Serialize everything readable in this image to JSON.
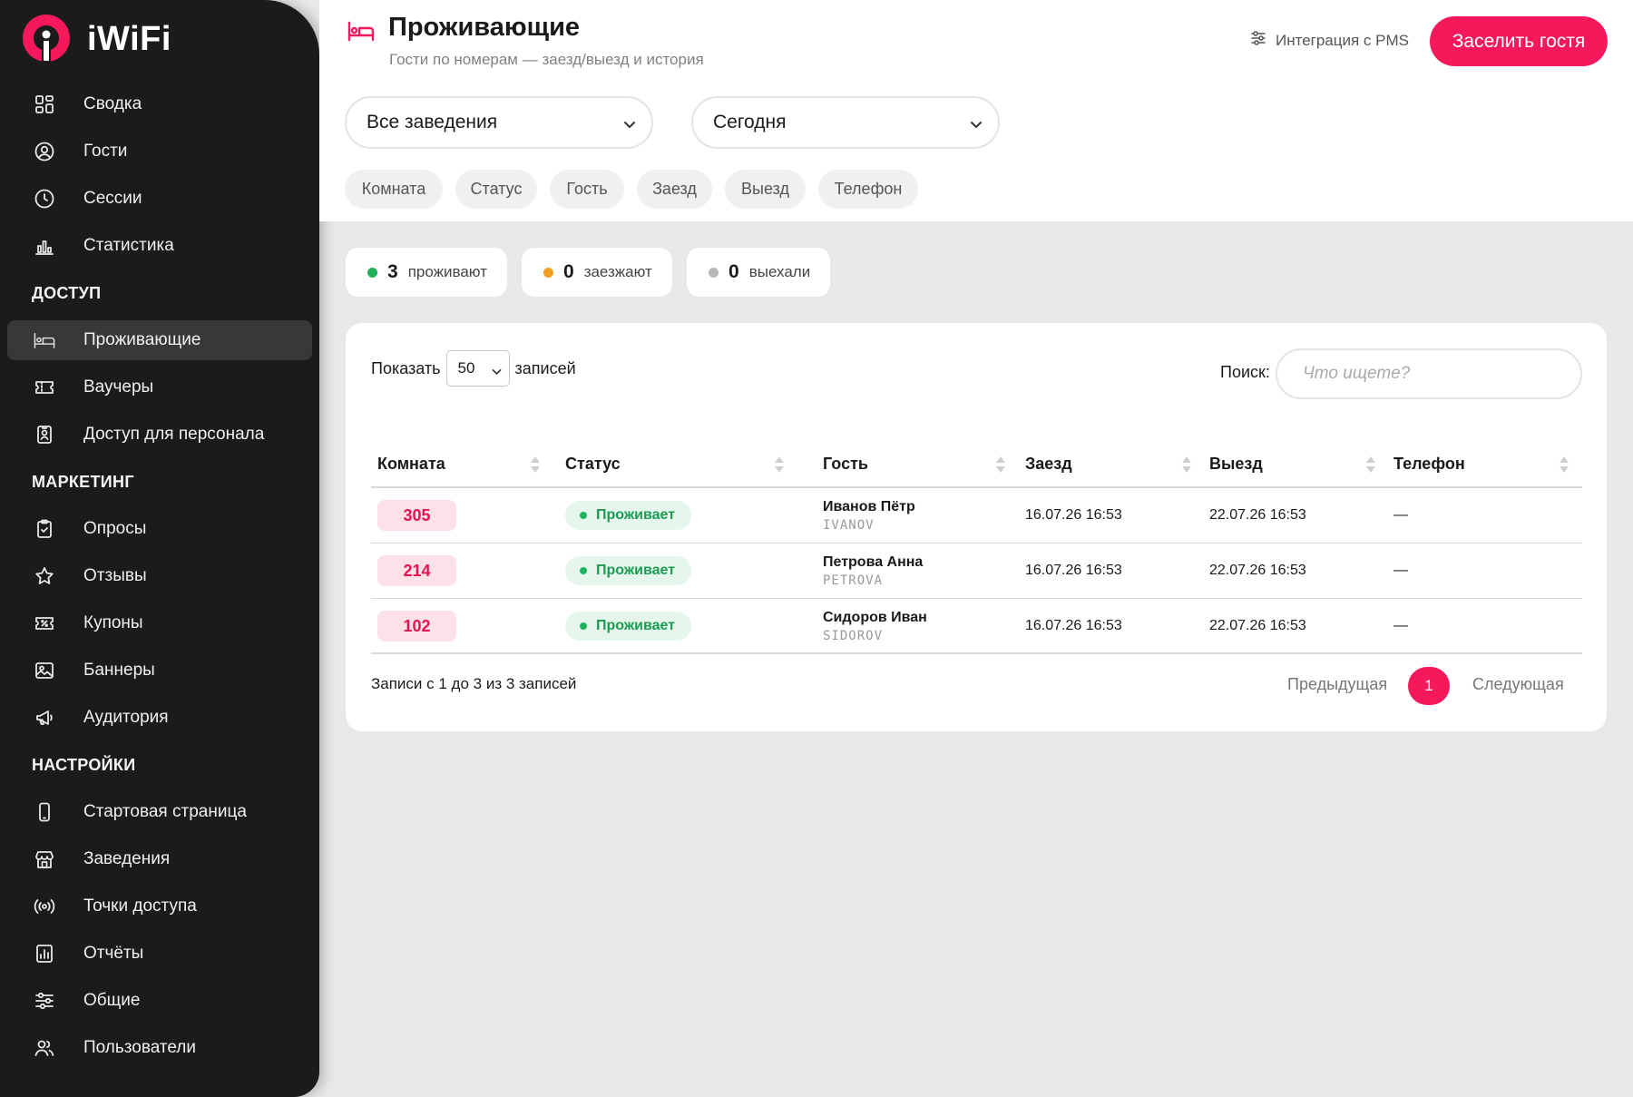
{
  "brand": {
    "name": "iWiFi",
    "accent": "#f5195c"
  },
  "sidebar": {
    "items": [
      {
        "type": "item",
        "label": "Сводка",
        "icon": "dashboard-icon"
      },
      {
        "type": "item",
        "label": "Гости",
        "icon": "user-circle-icon"
      },
      {
        "type": "item",
        "label": "Сессии",
        "icon": "clock-icon"
      },
      {
        "type": "item",
        "label": "Статистика",
        "icon": "chart-icon"
      },
      {
        "type": "section",
        "label": "ДОСТУП"
      },
      {
        "type": "item",
        "label": "Проживающие",
        "icon": "bed-icon",
        "active": true
      },
      {
        "type": "item",
        "label": "Ваучеры",
        "icon": "ticket-icon"
      },
      {
        "type": "item",
        "label": "Доступ для персонала",
        "icon": "badge-icon"
      },
      {
        "type": "section",
        "label": "МАРКЕТИНГ"
      },
      {
        "type": "item",
        "label": "Опросы",
        "icon": "clipboard-icon"
      },
      {
        "type": "item",
        "label": "Отзывы",
        "icon": "star-icon"
      },
      {
        "type": "item",
        "label": "Купоны",
        "icon": "coupon-icon"
      },
      {
        "type": "item",
        "label": "Баннеры",
        "icon": "image-icon"
      },
      {
        "type": "item",
        "label": "Аудитория",
        "icon": "megaphone-icon"
      },
      {
        "type": "section",
        "label": "НАСТРОЙКИ"
      },
      {
        "type": "item",
        "label": "Стартовая страница",
        "icon": "phone-icon"
      },
      {
        "type": "item",
        "label": "Заведения",
        "icon": "store-icon"
      },
      {
        "type": "item",
        "label": "Точки доступа",
        "icon": "broadcast-icon"
      },
      {
        "type": "item",
        "label": "Отчёты",
        "icon": "report-icon"
      },
      {
        "type": "item",
        "label": "Общие",
        "icon": "sliders-icon"
      },
      {
        "type": "item",
        "label": "Пользователи",
        "icon": "users-icon"
      }
    ]
  },
  "header": {
    "title": "Проживающие",
    "subtitle": "Гости по номерам — заезд/выезд и история",
    "pms_link": "Интеграция с PMS",
    "checkin_button": "Заселить гостя",
    "venue_select": "Все заведения",
    "period_select": "Сегодня",
    "chips": [
      "Комната",
      "Статус",
      "Гость",
      "Заезд",
      "Выезд",
      "Телефон"
    ]
  },
  "stats": [
    {
      "value": "3",
      "label": "проживают",
      "color": "#22b05a"
    },
    {
      "value": "0",
      "label": "заезжают",
      "color": "#f0a020"
    },
    {
      "value": "0",
      "label": "выехали",
      "color": "#b8b8b8"
    }
  ],
  "table": {
    "show_prefix": "Показать",
    "show_value": "50",
    "show_suffix": "записей",
    "search_label": "Поиск:",
    "search_placeholder": "Что ищете?",
    "columns": [
      "Комната",
      "Статус",
      "Гость",
      "Заезд",
      "Выезд",
      "Телефон"
    ],
    "rows": [
      {
        "room": "305",
        "status": "Проживает",
        "guest_name": "Иванов Пётр",
        "guest_latin": "IVANOV",
        "checkin": "16.07.26 16:53",
        "checkout": "22.07.26 16:53",
        "phone": "—"
      },
      {
        "room": "214",
        "status": "Проживает",
        "guest_name": "Петрова Анна",
        "guest_latin": "PETROVA",
        "checkin": "16.07.26 16:53",
        "checkout": "22.07.26 16:53",
        "phone": "—"
      },
      {
        "room": "102",
        "status": "Проживает",
        "guest_name": "Сидоров Иван",
        "guest_latin": "SIDOROV",
        "checkin": "16.07.26 16:53",
        "checkout": "22.07.26 16:53",
        "phone": "—"
      }
    ],
    "info": "Записи с 1 до 3 из 3 записей",
    "prev": "Предыдущая",
    "page": "1",
    "next": "Следующая"
  }
}
